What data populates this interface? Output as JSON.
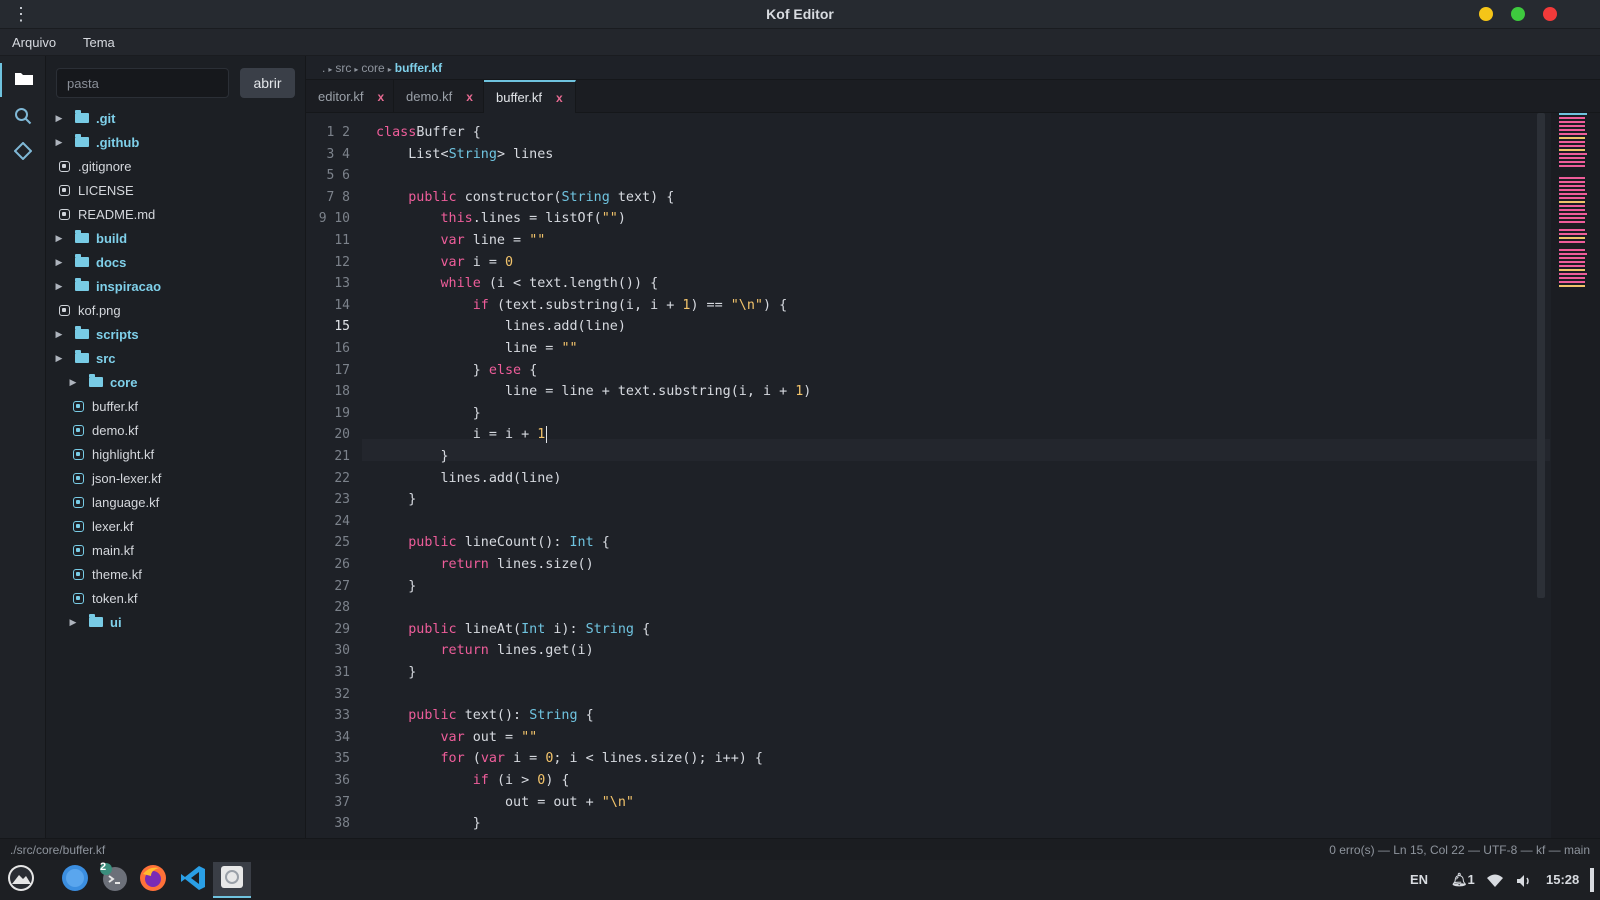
{
  "window": {
    "title": "Kof Editor"
  },
  "menu": {
    "file": "Arquivo",
    "theme": "Tema"
  },
  "activity": {
    "icons": [
      "folder-icon",
      "search-icon",
      "git-icon"
    ]
  },
  "sidebar": {
    "search_placeholder": "pasta",
    "open_label": "abrir",
    "tree": [
      {
        "type": "folder",
        "label": ".git",
        "depth": 0
      },
      {
        "type": "folder",
        "label": ".github",
        "depth": 0
      },
      {
        "type": "file",
        "label": ".gitignore",
        "depth": 0
      },
      {
        "type": "file",
        "label": "LICENSE",
        "depth": 0
      },
      {
        "type": "file",
        "label": "README.md",
        "depth": 0
      },
      {
        "type": "folder",
        "label": "build",
        "depth": 0
      },
      {
        "type": "folder",
        "label": "docs",
        "depth": 0
      },
      {
        "type": "folder",
        "label": "inspiracao",
        "depth": 0
      },
      {
        "type": "file",
        "label": "kof.png",
        "depth": 0
      },
      {
        "type": "folder",
        "label": "scripts",
        "depth": 0
      },
      {
        "type": "folder",
        "label": "src",
        "depth": 0
      },
      {
        "type": "folder",
        "label": "core",
        "depth": 1
      },
      {
        "type": "file",
        "label": "buffer.kf",
        "depth": 1
      },
      {
        "type": "file",
        "label": "demo.kf",
        "depth": 1
      },
      {
        "type": "file",
        "label": "highlight.kf",
        "depth": 1
      },
      {
        "type": "file",
        "label": "json-lexer.kf",
        "depth": 1
      },
      {
        "type": "file",
        "label": "language.kf",
        "depth": 1
      },
      {
        "type": "file",
        "label": "lexer.kf",
        "depth": 1
      },
      {
        "type": "file",
        "label": "main.kf",
        "depth": 1
      },
      {
        "type": "file",
        "label": "theme.kf",
        "depth": 1
      },
      {
        "type": "file",
        "label": "token.kf",
        "depth": 1
      },
      {
        "type": "folder",
        "label": "ui",
        "depth": 1
      }
    ]
  },
  "breadcrumb": {
    "parts": [
      ".",
      "src",
      "core"
    ],
    "current": "buffer.kf"
  },
  "tabs": [
    {
      "label": "editor.kf",
      "close": "x",
      "active": false
    },
    {
      "label": "demo.kf",
      "close": "x",
      "active": false
    },
    {
      "label": "buffer.kf",
      "close": "x",
      "active": true
    }
  ],
  "editor": {
    "gutter": [
      "1 2",
      "3 4",
      "5 6",
      "7 8",
      "9 10",
      "11",
      "12",
      "13",
      "14",
      "15",
      "16",
      "17",
      "18",
      "19",
      "20",
      "21",
      "22",
      "23",
      "24",
      "25",
      "26",
      "27",
      "28",
      "29",
      "30",
      "31",
      "32",
      "33",
      "34",
      "35",
      "36",
      "37",
      "38"
    ],
    "current_gutter": "15",
    "lines": [
      [
        [
          "kw",
          "class"
        ],
        [
          "",
          "Buffer {"
        ]
      ],
      [
        [
          "",
          "    List<"
        ],
        [
          "ty",
          "String"
        ],
        [
          "",
          "> lines"
        ]
      ],
      [],
      [
        [
          "",
          "    "
        ],
        [
          "kw",
          "public"
        ],
        [
          "",
          ""
        ],
        [
          "",
          "constructor("
        ],
        [
          "ty",
          "String"
        ],
        [
          "",
          ""
        ],
        [
          "",
          "text) {"
        ]
      ],
      [
        [
          "",
          "        "
        ],
        [
          "kw",
          "this"
        ],
        [
          "",
          ".lines = listOf("
        ],
        [
          "str",
          "\"\""
        ],
        [
          "",
          ")"
        ]
      ],
      [
        [
          "",
          "        "
        ],
        [
          "kw",
          "var"
        ],
        [
          "",
          ""
        ],
        [
          "",
          "line = "
        ],
        [
          "str",
          "\"\""
        ]
      ],
      [
        [
          "",
          "        "
        ],
        [
          "kw",
          "var"
        ],
        [
          "",
          ""
        ],
        [
          "",
          "i = "
        ],
        [
          "num",
          "0"
        ]
      ],
      [
        [
          "",
          "        "
        ],
        [
          "kw",
          "while"
        ],
        [
          "",
          ""
        ],
        [
          "",
          "(i < text.length()) {"
        ]
      ],
      [
        [
          "",
          "            "
        ],
        [
          "kw",
          "if"
        ],
        [
          "",
          ""
        ],
        [
          "",
          "(text.substring(i, i + "
        ],
        [
          "num",
          "1"
        ],
        [
          "",
          ") == "
        ],
        [
          "str",
          "\"\\n\""
        ],
        [
          "",
          ") {"
        ]
      ],
      [
        [
          "",
          "                lines.add(line)"
        ]
      ],
      [
        [
          "",
          "                line = "
        ],
        [
          "str",
          "\"\""
        ]
      ],
      [
        [
          "",
          "            } "
        ],
        [
          "kw",
          "else"
        ],
        [
          "",
          ""
        ],
        [
          "",
          "{"
        ]
      ],
      [
        [
          "",
          "                line = line + text.substring(i, i + "
        ],
        [
          "num",
          "1"
        ],
        [
          "",
          ")"
        ]
      ],
      [
        [
          "",
          "            }"
        ]
      ],
      [
        [
          "",
          "            i = i + "
        ],
        [
          "num",
          "1"
        ]
      ],
      [
        [
          "",
          "        }"
        ]
      ],
      [
        [
          "",
          "        lines.add(line)"
        ]
      ],
      [
        [
          "",
          "    }"
        ]
      ],
      [],
      [
        [
          "",
          "    "
        ],
        [
          "kw",
          "public"
        ],
        [
          "",
          ""
        ],
        [
          "",
          "lineCount(): "
        ],
        [
          "ty",
          "Int"
        ],
        [
          "",
          ""
        ],
        [
          "",
          "{"
        ]
      ],
      [
        [
          "",
          "        "
        ],
        [
          "kw",
          "return"
        ],
        [
          "",
          ""
        ],
        [
          "",
          "lines.size()"
        ]
      ],
      [
        [
          "",
          "    }"
        ]
      ],
      [],
      [
        [
          "",
          "    "
        ],
        [
          "kw",
          "public"
        ],
        [
          "",
          ""
        ],
        [
          "",
          "lineAt("
        ],
        [
          "ty",
          "Int"
        ],
        [
          "",
          ""
        ],
        [
          "",
          "i): "
        ],
        [
          "ty",
          "String"
        ],
        [
          "",
          ""
        ],
        [
          "",
          "{"
        ]
      ],
      [
        [
          "",
          "        "
        ],
        [
          "kw",
          "return"
        ],
        [
          "",
          ""
        ],
        [
          "",
          "lines.get(i)"
        ]
      ],
      [
        [
          "",
          "    }"
        ]
      ],
      [],
      [
        [
          "",
          "    "
        ],
        [
          "kw",
          "public"
        ],
        [
          "",
          ""
        ],
        [
          "",
          "text(): "
        ],
        [
          "ty",
          "String"
        ],
        [
          "",
          ""
        ],
        [
          "",
          "{"
        ]
      ],
      [
        [
          "",
          "        "
        ],
        [
          "kw",
          "var"
        ],
        [
          "",
          ""
        ],
        [
          "",
          "out = "
        ],
        [
          "str",
          "\"\""
        ]
      ],
      [
        [
          "",
          "        "
        ],
        [
          "kw",
          "for"
        ],
        [
          "",
          ""
        ],
        [
          "",
          "("
        ],
        [
          "kw",
          "var"
        ],
        [
          "",
          ""
        ],
        [
          "",
          "i = "
        ],
        [
          "num",
          "0"
        ],
        [
          "",
          "; i < lines.size(); i++) {"
        ]
      ],
      [
        [
          "",
          "            "
        ],
        [
          "kw",
          "if"
        ],
        [
          "",
          ""
        ],
        [
          "",
          "(i > "
        ],
        [
          "num",
          "0"
        ],
        [
          "",
          ") {"
        ]
      ],
      [
        [
          "",
          "                out = out + "
        ],
        [
          "str",
          "\"\\n\""
        ]
      ],
      [
        [
          "",
          "            }"
        ]
      ]
    ],
    "cursor_line": 14
  },
  "status": {
    "path": "./src/core/buffer.kf",
    "info": "0 erro(s) — Ln 15, Col 22 — UTF-8 — kf — main"
  },
  "taskbar": {
    "apps": [
      "launcher-icon",
      "files-icon",
      "terminal-icon",
      "firefox-icon",
      "vscode-icon",
      "kof-editor-icon"
    ],
    "terminal_badge": "2",
    "lang": "EN",
    "notif_count": "1",
    "clock": "15:28"
  },
  "colors": {
    "accent": "#6fc3df",
    "keyword": "#ee5d9a",
    "string": "#f2c36b",
    "close": "#e86a92",
    "yellow": "#f5c518",
    "green": "#3ec93e",
    "red": "#f23a3a"
  }
}
